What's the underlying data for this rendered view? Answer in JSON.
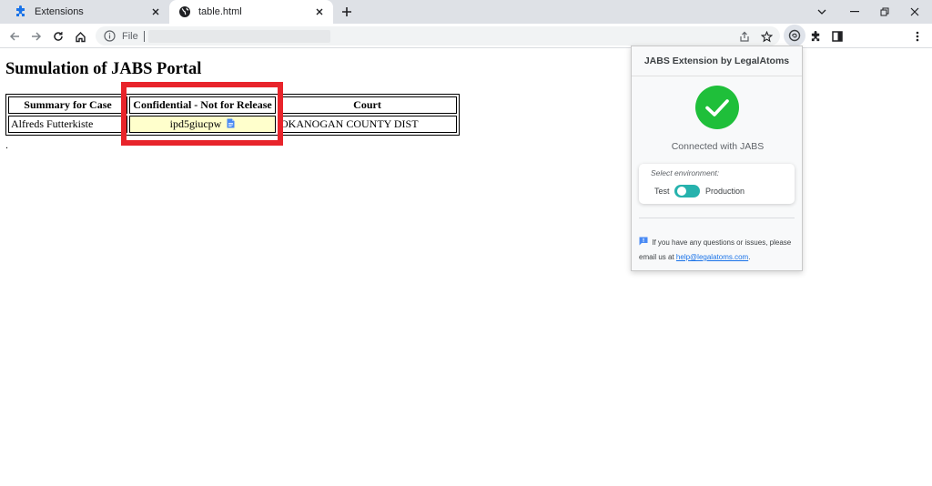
{
  "browser": {
    "tabs": [
      {
        "title": "Extensions",
        "icon": "puzzle-icon"
      },
      {
        "title": "table.html",
        "icon": "globe-icon",
        "active": true
      }
    ],
    "address": {
      "scheme_label": "File",
      "url": ""
    }
  },
  "page": {
    "title": "Sumulation of JABS Portal",
    "table": {
      "headers": [
        "Summary for Case",
        "Confidential - Not for Release",
        "Court"
      ],
      "rows": [
        {
          "case": "Alfreds Futterkiste",
          "confidential": "ipd5giucpw",
          "court": "OKANOGAN COUNTY DIST"
        }
      ]
    },
    "trailing_text": "."
  },
  "extension_popup": {
    "title": "JABS Extension by LegalAtoms",
    "status": "Connected with JABS",
    "environment": {
      "label": "Select environment:",
      "left_option": "Test",
      "right_option": "Production",
      "selected": "Production"
    },
    "help": {
      "text": "If you have any questions or issues, please email us at",
      "email": "help@legalatoms.com",
      "suffix": "."
    }
  },
  "colors": {
    "highlight": "#e8242b",
    "check": "#1fbf3a",
    "toggle": "#26b2ad",
    "confidential_cell": "#ffffcc"
  }
}
